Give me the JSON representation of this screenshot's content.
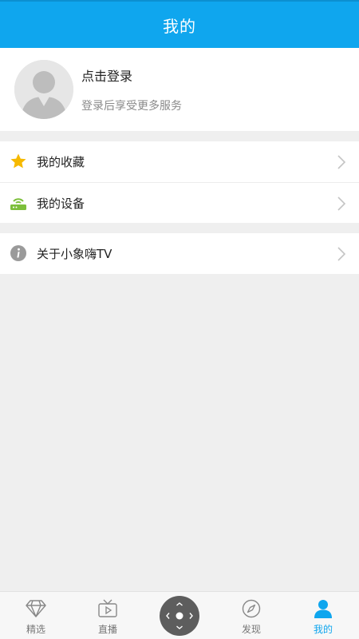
{
  "header": {
    "title": "我的"
  },
  "profile": {
    "login_title": "点击登录",
    "login_subtitle": "登录后享受更多服务",
    "avatar_icon": "default-avatar-icon"
  },
  "menu": {
    "group1": [
      {
        "label": "我的收藏",
        "icon": "star-icon",
        "icon_color": "#f6b900"
      },
      {
        "label": "我的设备",
        "icon": "router-icon",
        "icon_color": "#7cbf3a"
      }
    ],
    "group2": [
      {
        "label": "关于小象嗨TV",
        "icon": "info-icon",
        "icon_color": "#9a9a9a"
      }
    ]
  },
  "tabbar": {
    "tabs": [
      {
        "label": "精选",
        "icon": "diamond-icon"
      },
      {
        "label": "直播",
        "icon": "tv-icon"
      },
      {
        "label": "发现",
        "icon": "compass-icon"
      },
      {
        "label": "我的",
        "icon": "person-icon",
        "active": true
      }
    ],
    "center_button_icon": "remote-dpad-icon"
  },
  "colors": {
    "accent": "#0fa6ee",
    "background": "#efefef",
    "text_primary": "#222222",
    "text_secondary": "#8a8a8a"
  }
}
